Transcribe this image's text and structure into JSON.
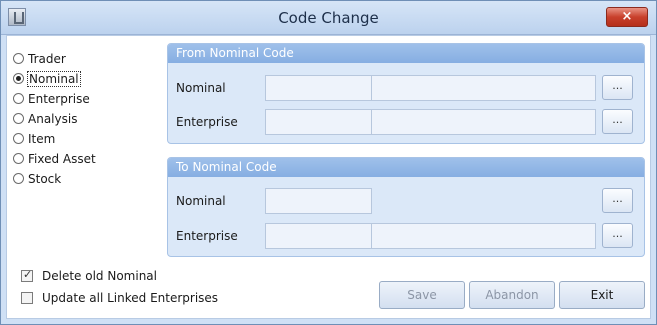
{
  "window": {
    "title": "Code Change",
    "close_label": "×"
  },
  "code_types": [
    {
      "label": "Trader",
      "selected": false
    },
    {
      "label": "Nominal",
      "selected": true
    },
    {
      "label": "Enterprise",
      "selected": false
    },
    {
      "label": "Analysis",
      "selected": false
    },
    {
      "label": "Item",
      "selected": false
    },
    {
      "label": "Fixed Asset",
      "selected": false
    },
    {
      "label": "Stock",
      "selected": false
    }
  ],
  "from_group": {
    "title": "From Nominal Code",
    "nominal_label": "Nominal",
    "enterprise_label": "Enterprise",
    "nominal_value": "",
    "nominal_desc": "",
    "enterprise_value": "",
    "enterprise_desc": "",
    "lookup_label": "..."
  },
  "to_group": {
    "title": "To Nominal Code",
    "nominal_label": "Nominal",
    "enterprise_label": "Enterprise",
    "nominal_value": "",
    "enterprise_value": "",
    "enterprise_desc": "",
    "lookup_label": "..."
  },
  "options": {
    "delete_old": {
      "label": "Delete old Nominal",
      "checked": true
    },
    "update_linked": {
      "label": "Update all Linked Enterprises",
      "checked": false
    }
  },
  "buttons": {
    "save": {
      "label": "Save",
      "enabled": false
    },
    "abandon": {
      "label": "Abandon",
      "enabled": false
    },
    "exit": {
      "label": "Exit",
      "enabled": true
    }
  }
}
